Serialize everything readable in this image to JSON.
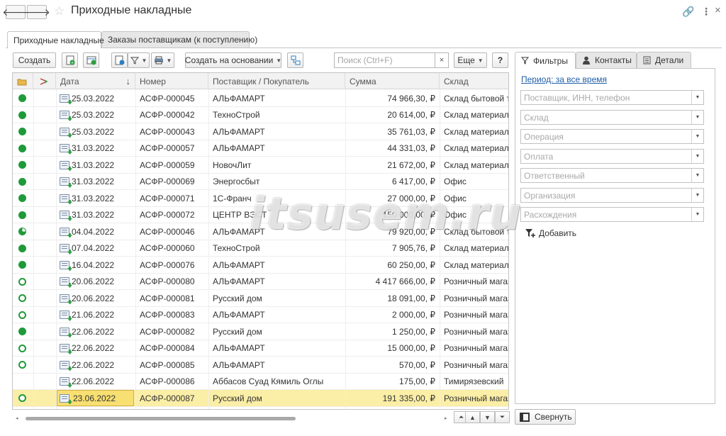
{
  "header": {
    "title": "Приходные накладные",
    "back_icon": "arrow-left-icon",
    "forward_icon": "arrow-right-icon",
    "favorite_icon": "star-icon",
    "link_icon": "link-icon",
    "more_icon": "more-icon",
    "close_icon": "close-icon"
  },
  "tabs": [
    {
      "label": "Приходные накладные",
      "active": true
    },
    {
      "label": "Заказы поставщикам (к поступлению)",
      "active": false
    }
  ],
  "toolbar": {
    "create_label": "Создать",
    "create_basis_label": "Создать на основании",
    "more_label": "Еще",
    "help_label": "?",
    "search_placeholder": "Поиск (Ctrl+F)",
    "search_clear": "×"
  },
  "table": {
    "columns": [
      "Дата",
      "Номер",
      "Поставщик / Покупатель",
      "Сумма",
      "Склад"
    ],
    "sort_indicator": "↓",
    "rows": [
      {
        "status": "filled",
        "date": "25.03.2022",
        "number": "АСФР-000045",
        "partner": "АЛЬФАМАРТ",
        "sum": "74 966,30, ₽",
        "warehouse": "Склад бытовой техники"
      },
      {
        "status": "filled",
        "date": "25.03.2022",
        "number": "АСФР-000042",
        "partner": "ТехноСтрой",
        "sum": "20 614,00, ₽",
        "warehouse": "Склад материалов"
      },
      {
        "status": "filled",
        "date": "25.03.2022",
        "number": "АСФР-000043",
        "partner": "АЛЬФАМАРТ",
        "sum": "35 761,03, ₽",
        "warehouse": "Склад материалов"
      },
      {
        "status": "filled",
        "date": "31.03.2022",
        "number": "АСФР-000057",
        "partner": "АЛЬФАМАРТ",
        "sum": "44 331,03, ₽",
        "warehouse": "Склад материалов"
      },
      {
        "status": "filled",
        "date": "31.03.2022",
        "number": "АСФР-000059",
        "partner": "НовочЛит",
        "sum": "21 672,00, ₽",
        "warehouse": "Склад материалов"
      },
      {
        "status": "filled",
        "date": "31.03.2022",
        "number": "АСФР-000069",
        "partner": "Энергосбыт",
        "sum": "6 417,00, ₽",
        "warehouse": "Офис"
      },
      {
        "status": "filled",
        "date": "31.03.2022",
        "number": "АСФР-000071",
        "partner": "1С-Франч",
        "sum": "27 000,00, ₽",
        "warehouse": "Офис"
      },
      {
        "status": "filled",
        "date": "31.03.2022",
        "number": "АСФР-000072",
        "partner": "ЦЕНТР ВЭСТ",
        "sum": "150 000,00, ₽",
        "warehouse": "Офис"
      },
      {
        "status": "partial",
        "date": "04.04.2022",
        "number": "АСФР-000046",
        "partner": "АЛЬФАМАРТ",
        "sum": "79 920,00, ₽",
        "warehouse": "Склад бытовой техники"
      },
      {
        "status": "filled",
        "date": "07.04.2022",
        "number": "АСФР-000060",
        "partner": "ТехноСтрой",
        "sum": "7 905,76, ₽",
        "warehouse": "Склад материалов"
      },
      {
        "status": "filled",
        "date": "16.04.2022",
        "number": "АСФР-000076",
        "partner": "АЛЬФАМАРТ",
        "sum": "60 250,00, ₽",
        "warehouse": "Склад материалов"
      },
      {
        "status": "ring",
        "date": "20.06.2022",
        "number": "АСФР-000080",
        "partner": "АЛЬФАМАРТ",
        "sum": "4 417 666,00, ₽",
        "warehouse": "Розничный магазин"
      },
      {
        "status": "ring",
        "date": "20.06.2022",
        "number": "АСФР-000081",
        "partner": "Русский дом",
        "sum": "18 091,00, ₽",
        "warehouse": "Розничный магазин"
      },
      {
        "status": "ring",
        "date": "21.06.2022",
        "number": "АСФР-000083",
        "partner": "АЛЬФАМАРТ",
        "sum": "2 000,00, ₽",
        "warehouse": "Розничный магазин"
      },
      {
        "status": "filled",
        "date": "22.06.2022",
        "number": "АСФР-000082",
        "partner": "Русский дом",
        "sum": "1 250,00, ₽",
        "warehouse": "Розничный магазин"
      },
      {
        "status": "ring",
        "date": "22.06.2022",
        "number": "АСФР-000084",
        "partner": "АЛЬФАМАРТ",
        "sum": "15 000,00, ₽",
        "warehouse": "Розничный магазин"
      },
      {
        "status": "ring",
        "date": "22.06.2022",
        "number": "АСФР-000085",
        "partner": "АЛЬФАМАРТ",
        "sum": "570,00, ₽",
        "warehouse": "Розничный магазин"
      },
      {
        "status": "none",
        "date": "22.06.2022",
        "number": "АСФР-000086",
        "partner": "Аббасов Суад Кямиль Оглы",
        "sum": "175,00, ₽",
        "warehouse": "Тимирязевский"
      },
      {
        "status": "ring",
        "date": "23.06.2022",
        "number": "АСФР-000087",
        "partner": "Русский дом",
        "sum": "191 335,00, ₽",
        "warehouse": "Розничный магазин",
        "selected": true
      }
    ]
  },
  "panel": {
    "tabs": [
      {
        "label": "Фильтры",
        "icon": "filter-icon",
        "active": true
      },
      {
        "label": "Контакты",
        "icon": "person-icon",
        "active": false
      },
      {
        "label": "Детали",
        "icon": "details-icon",
        "active": false
      }
    ],
    "period_label": "Период: за все время",
    "filters": [
      "Поставщик, ИНН, телефон",
      "Склад",
      "Операция",
      "Оплата",
      "Ответственный",
      "Организация",
      "Расхождения"
    ],
    "add_label": "Добавить",
    "collapse_label": "Свернуть"
  },
  "watermark": "itsusem.ru",
  "colors": {
    "status_green": "#1e9a3a",
    "selected_row": "#fbeea6",
    "link_blue": "#1f5ea8"
  }
}
